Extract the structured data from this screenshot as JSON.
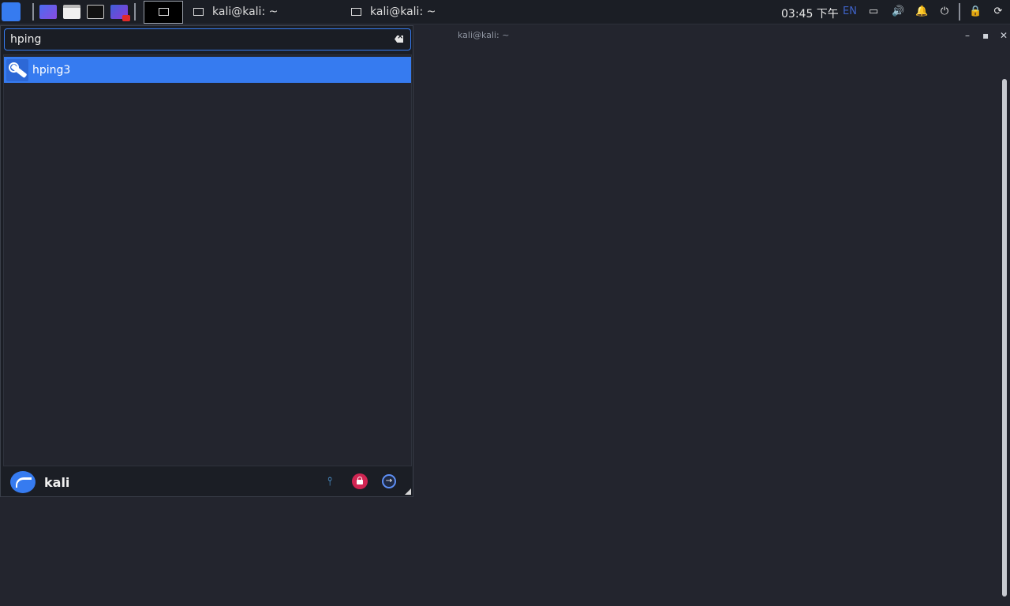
{
  "panel": {
    "tasks": [
      {
        "label": "kali@kali: ~"
      },
      {
        "label": "kali@kali: ~"
      }
    ],
    "clock": "03:45 下午",
    "lang": "EN"
  },
  "terminal": {
    "title": "kali@kali: ~",
    "min_glyph": "–",
    "max_glyph": "▪",
    "close_glyph": "✕"
  },
  "menu": {
    "search": {
      "value": "hping"
    },
    "results": [
      {
        "label": "hping3",
        "icon": "hping3-icon"
      }
    ],
    "footer": {
      "user": "kali",
      "settings_glyph": "⫯",
      "logout_glyph": "→"
    }
  },
  "colors": {
    "accent": "#367bf0",
    "panel_bg": "#1b1e25",
    "window_bg": "#23252e",
    "lock": "#d12552"
  }
}
